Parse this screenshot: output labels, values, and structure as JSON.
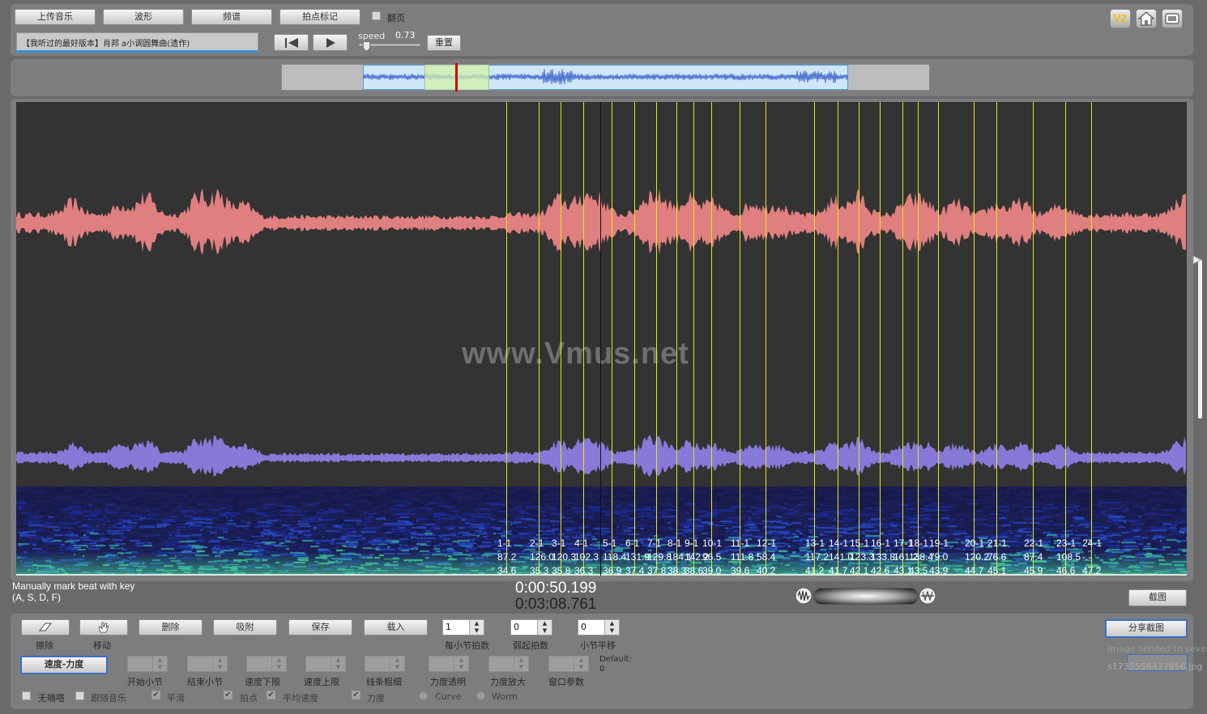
{
  "toolbar": {
    "upload_label": "上传音乐",
    "waveform_label": "波形",
    "spectrum_label": "频谱",
    "beat_mark_label": "拍点标记",
    "flip_page_label": "翻页",
    "track_title": "【我听过的最好版本】肖邦 a小调圆舞曲(遗作)",
    "speed_label": "speed",
    "speed_value": "0.73",
    "reset_label": "重置",
    "v2_label": "V2"
  },
  "display": {
    "watermark": "www.Vmus.net",
    "current_time": "0:00:50.199",
    "total_time": "0:03:08.761",
    "hint_line1": "Manually mark beat with key",
    "hint_line2": "(A, S, D, F)",
    "screenshot_label": "截图"
  },
  "beats": [
    {
      "measure": "1-1",
      "tempo": "87.2",
      "time": "34.6"
    },
    {
      "measure": "2-1",
      "tempo": "126.0",
      "time": "35.3"
    },
    {
      "measure": "3-1",
      "tempo": "120.3",
      "time": "35.8"
    },
    {
      "measure": "4-1",
      "tempo": "102.3",
      "time": "36.3"
    },
    {
      "measure": "5-1",
      "tempo": "118.4",
      "time": "36.9"
    },
    {
      "measure": "6-1",
      "tempo": "131.9",
      "time": "37.4"
    },
    {
      "measure": "7-1",
      "tempo": "129.8",
      "time": "37.8"
    },
    {
      "measure": "8-1",
      "tempo": "184.1",
      "time": "38.3"
    },
    {
      "measure": "9-1",
      "tempo": "142.2",
      "time": "38.6"
    },
    {
      "measure": "10-1",
      "tempo": "96.5",
      "time": "39.0"
    },
    {
      "measure": "11-1",
      "tempo": "111.8",
      "time": "39.6"
    },
    {
      "measure": "12-1",
      "tempo": "58.4",
      "time": "40.2"
    },
    {
      "measure": "13-1",
      "tempo": "117.2",
      "time": "41.2"
    },
    {
      "measure": "14-1",
      "tempo": "141.0",
      "time": "41.7"
    },
    {
      "measure": "15-1",
      "tempo": "123.3",
      "time": "42.1"
    },
    {
      "measure": "16-1",
      "tempo": "133.8",
      "time": "42.6"
    },
    {
      "measure": "17-1",
      "tempo": "161.2",
      "time": "43.1"
    },
    {
      "measure": "18-1",
      "tempo": "138.4",
      "time": "43.5"
    },
    {
      "measure": "19-1",
      "tempo": "79.0",
      "time": "43.9"
    },
    {
      "measure": "20-1",
      "tempo": "120.2",
      "time": "44.7"
    },
    {
      "measure": "21-1",
      "tempo": "76.6",
      "time": "45.1"
    },
    {
      "measure": "22-1",
      "tempo": "87.4",
      "time": "45.9"
    },
    {
      "measure": "23-1",
      "tempo": "108.5",
      "time": "46.6"
    },
    {
      "measure": "24-1",
      "tempo": "-.-",
      "time": "47.2"
    }
  ],
  "bottom": {
    "erase_label": "擦除",
    "move_label": "移动",
    "delete_label": "删除",
    "snap_label": "吸附",
    "save_label": "保存",
    "load_label": "载入",
    "beats_per_bar_label": "每小节拍数",
    "beats_per_bar_value": "1",
    "weak_beats_label": "弱起拍数",
    "weak_beats_value": "0",
    "bar_shift_label": "小节平移",
    "bar_shift_value": "0",
    "share_label": "分享截图",
    "image_sent_text": "Image sended to seve",
    "file_name": "s1735556437856.jpg",
    "tempo_dynamics_label": "速度-力度",
    "start_bar_label": "开始小节",
    "end_bar_label": "结束小节",
    "tempo_low_label": "速度下限",
    "tempo_high_label": "速度上限",
    "line_width_label": "线条粗细",
    "dyn_transparency_label": "力度透明",
    "dyn_zoom_label": "力度放大",
    "window_param_label": "窗口参数",
    "default_label": "Default:",
    "default_value": "0",
    "no_tick_label": "无嘀嗒",
    "follow_music_label": "跟随音乐",
    "smooth_label": "平滑",
    "beat_label": "拍点",
    "avg_tempo_label": "平均速度",
    "dynamics_label": "力度",
    "curve_label": "Curve",
    "worm_label": "Worm"
  },
  "colors": {
    "upper_wave": "#e07f7f",
    "lower_wave": "#8878d8",
    "beat_line": "#e5e51f",
    "playhead": "#cc0000"
  }
}
